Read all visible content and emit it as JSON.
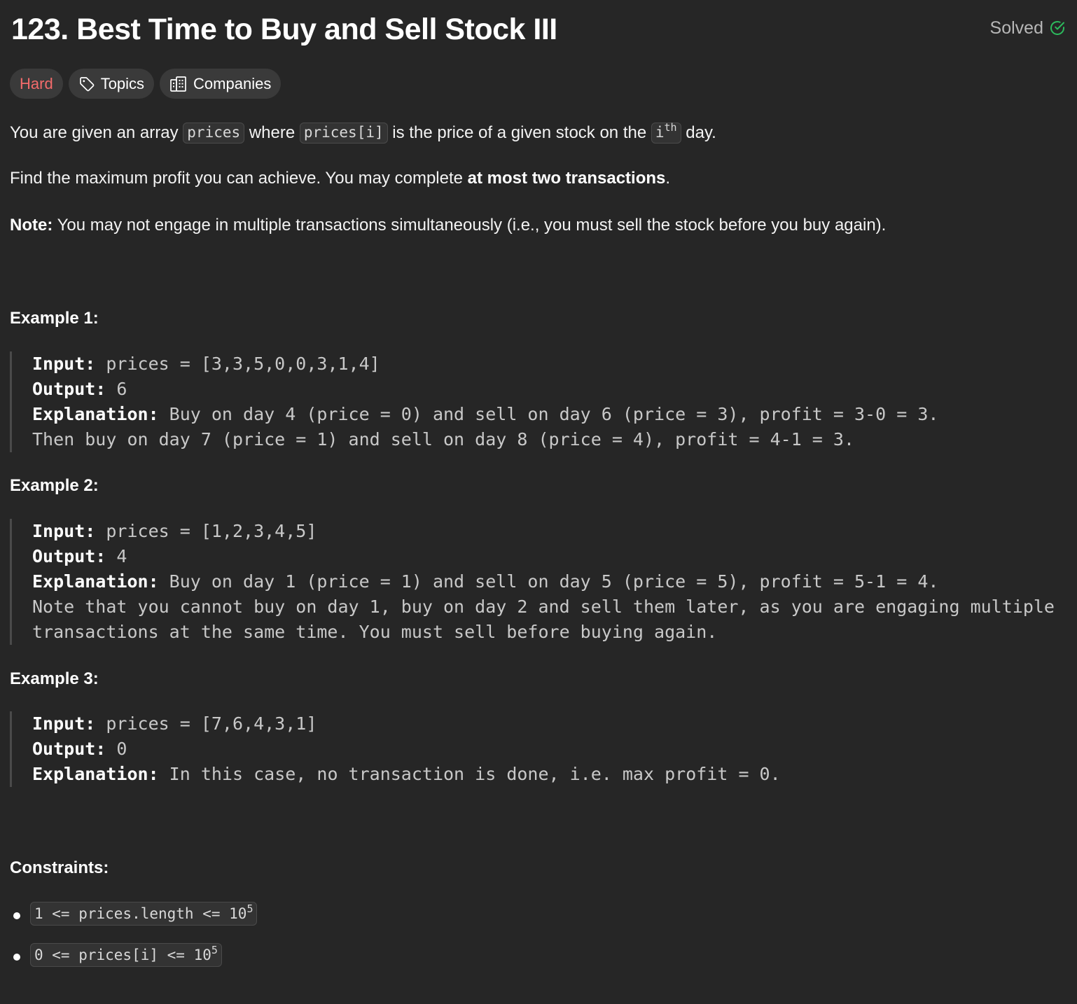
{
  "header": {
    "title": "123. Best Time to Buy and Sell Stock III",
    "status_label": "Solved",
    "status_color": "#2cbb5d"
  },
  "tags": {
    "difficulty": "Hard",
    "difficulty_color": "#f36b6b",
    "topics": "Topics",
    "companies": "Companies"
  },
  "description": {
    "p1_a": "You are given an array ",
    "p1_code1": "prices",
    "p1_b": " where ",
    "p1_code2": "prices[i]",
    "p1_c": " is the price of a given stock on the ",
    "p1_code3_base": "i",
    "p1_code3_sup": "th",
    "p1_d": " day.",
    "p2_a": "Find the maximum profit you can achieve. You may complete ",
    "p2_bold": "at most two transactions",
    "p2_b": ".",
    "note_label": "Note:",
    "note_text": " You may not engage in multiple transactions simultaneously (i.e., you must sell the stock before you buy again)."
  },
  "examples": [
    {
      "title": "Example 1:",
      "input_label": "Input:",
      "input": " prices = [3,3,5,0,0,3,1,4]",
      "output_label": "Output:",
      "output": " 6",
      "explanation_label": "Explanation:",
      "explanation_lines": [
        " Buy on day 4 (price = 0) and sell on day 6 (price = 3), profit = 3-0 = 3.",
        "Then buy on day 7 (price = 1) and sell on day 8 (price = 4), profit = 4-1 = 3."
      ]
    },
    {
      "title": "Example 2:",
      "input_label": "Input:",
      "input": " prices = [1,2,3,4,5]",
      "output_label": "Output:",
      "output": " 4",
      "explanation_label": "Explanation:",
      "explanation_lines": [
        " Buy on day 1 (price = 1) and sell on day 5 (price = 5), profit = 5-1 = 4.",
        "Note that you cannot buy on day 1, buy on day 2 and sell them later, as you are engaging multiple",
        "transactions at the same time. You must sell before buying again."
      ]
    },
    {
      "title": "Example 3:",
      "input_label": "Input:",
      "input": " prices = [7,6,4,3,1]",
      "output_label": "Output:",
      "output": " 0",
      "explanation_label": "Explanation:",
      "explanation_lines": [
        " In this case, no transaction is done, i.e. max profit = 0."
      ]
    }
  ],
  "constraints": {
    "title": "Constraints:",
    "items": [
      {
        "base": "1 <= prices.length <= 10",
        "sup": "5"
      },
      {
        "base": "0 <= prices[i] <= 10",
        "sup": "5"
      }
    ]
  }
}
